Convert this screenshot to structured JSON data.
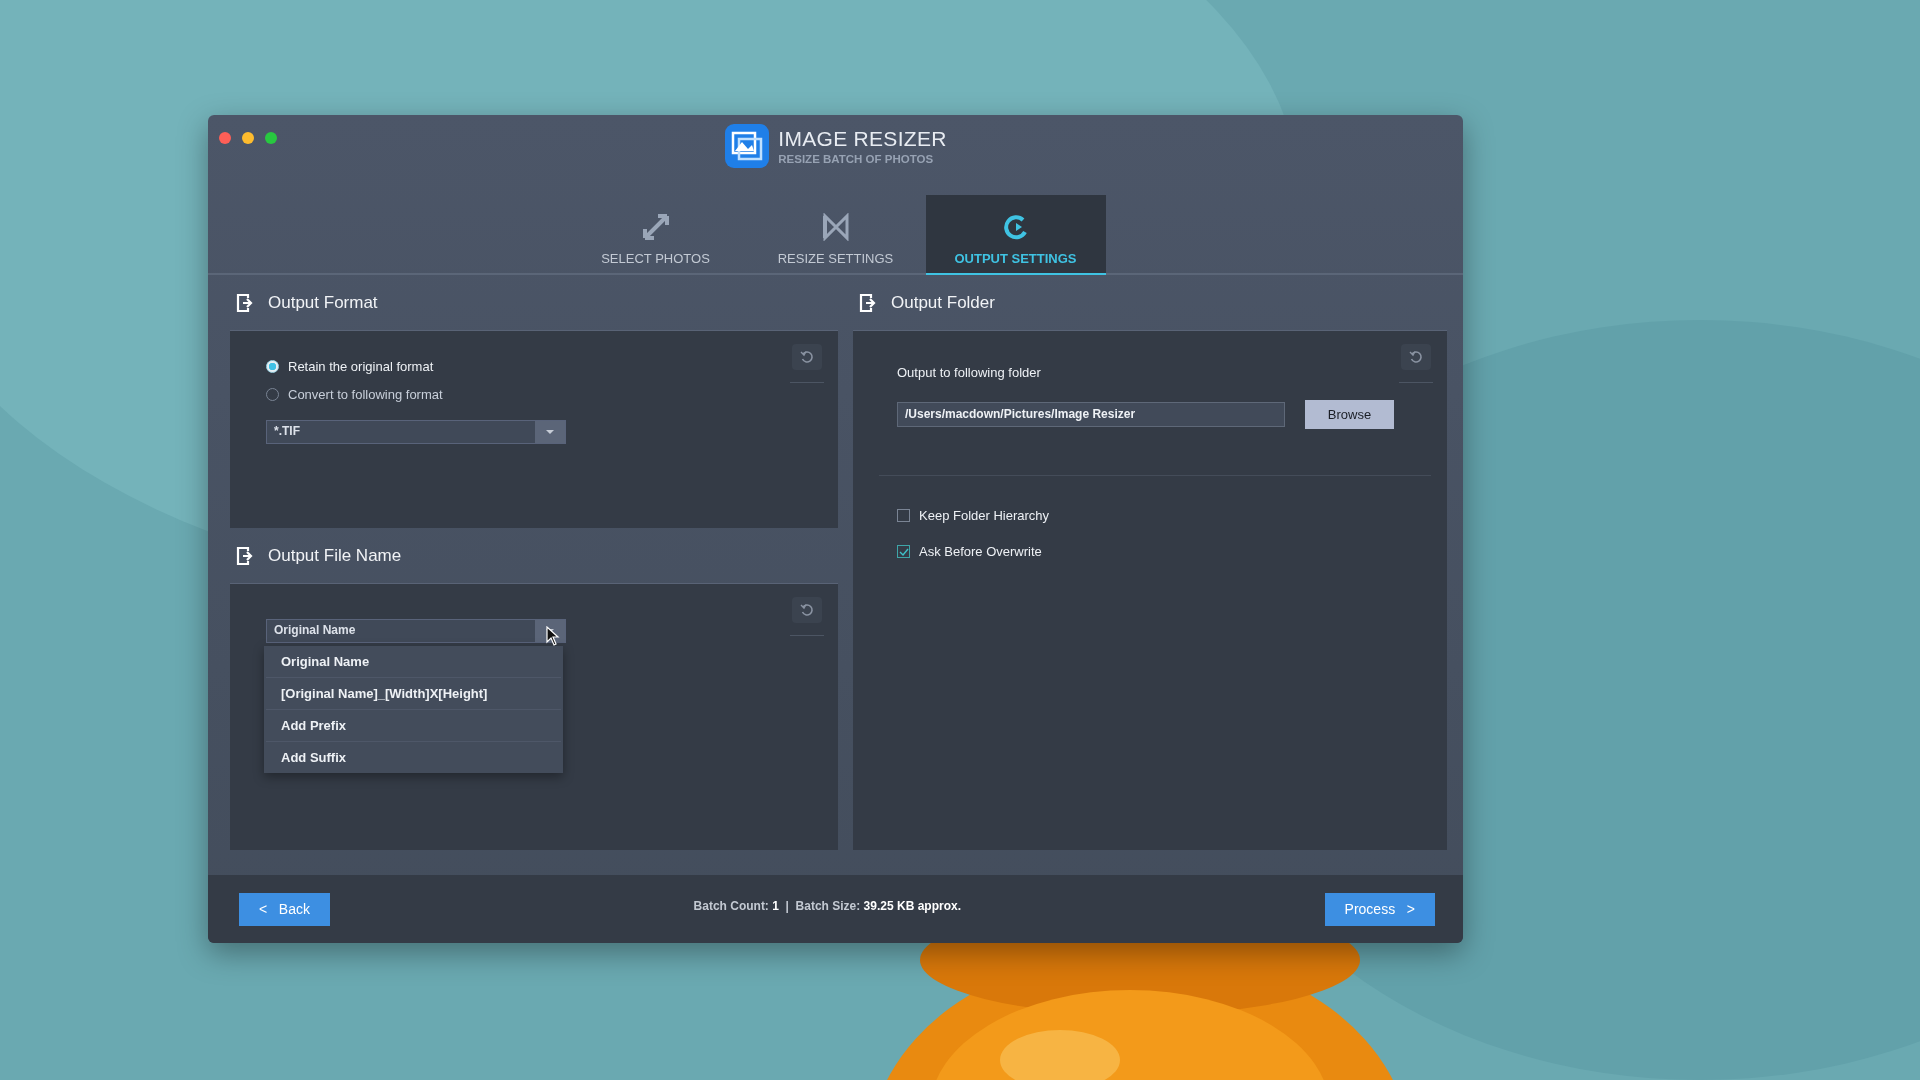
{
  "window": {
    "title": "IMAGE RESIZER",
    "subtitle": "RESIZE BATCH OF PHOTOS"
  },
  "tabs": [
    {
      "label": "SELECT PHOTOS",
      "selected": false
    },
    {
      "label": "RESIZE SETTINGS",
      "selected": false
    },
    {
      "label": "OUTPUT SETTINGS",
      "selected": true
    }
  ],
  "output_format": {
    "title": "Output Format",
    "options": [
      {
        "label": "Retain the original format",
        "selected": true
      },
      {
        "label": "Convert to  following format",
        "selected": false
      }
    ],
    "format_select": {
      "value": "*.TIF"
    }
  },
  "output_file_name": {
    "title": "Output File Name",
    "select": {
      "value": "Original Name",
      "expanded": true
    },
    "menu": [
      {
        "label": "Original Name"
      },
      {
        "label": "[Original Name]_[Width]X[Height]"
      },
      {
        "label": "Add Prefix"
      },
      {
        "label": "Add Suffix"
      }
    ]
  },
  "output_folder": {
    "title": "Output Folder",
    "label": "Output to following folder",
    "path": "/Users/macdown/Pictures/Image Resizer",
    "browse": "Browse",
    "checkboxes": [
      {
        "label": "Keep Folder Hierarchy",
        "checked": false
      },
      {
        "label": "Ask Before Overwrite",
        "checked": true
      }
    ]
  },
  "footer": {
    "back": "<   Back",
    "status": "Batch Count: **1**  |  Batch Size: **39.25 KB approx.**",
    "process": "Process   >"
  }
}
